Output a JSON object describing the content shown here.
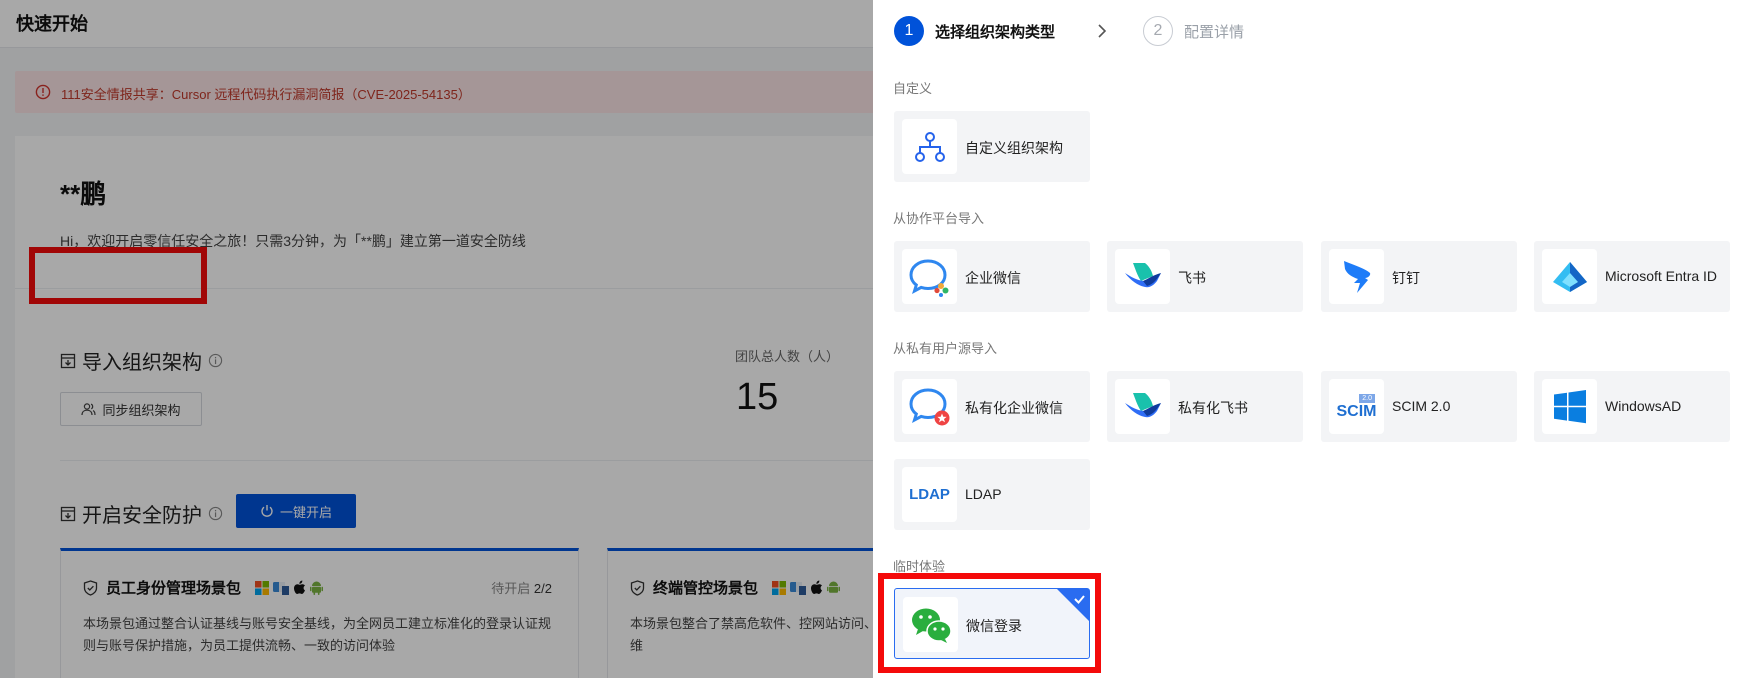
{
  "topbar": {
    "title": "快速开始"
  },
  "alert": {
    "text": "111安全情报共享：Cursor 远程代码执行漏洞简报（CVE-2025-54135）"
  },
  "greeting": {
    "name": "**鹏",
    "message": "Hi，欢迎开启零信任安全之旅！只需3分钟，为「**鹏」建立第一道安全防线"
  },
  "import_section": {
    "title": "导入组织架构",
    "sync_button": "同步组织架构",
    "team_label": "团队总人数（人）",
    "team_count": "15"
  },
  "protect_section": {
    "title": "开启安全防护",
    "enable_button": "一键开启",
    "packages": [
      {
        "title": "员工身份管理场景包",
        "status_prefix": "待开启",
        "status_value": "2/2",
        "desc": "本场景包通过整合认证基线与账号安全基线，为全网员工建立标准化的登录认证规则与账号保护措施，为员工提供流畅、一致的访问体验"
      },
      {
        "title": "终端管控场景包",
        "status_prefix": "",
        "status_value": "",
        "desc": "本场景包整合了禁高危软件、控网站访问、大策略，旨在从内容、网络、外设多个维"
      }
    ]
  },
  "drawer": {
    "steps": [
      {
        "number": "1",
        "label": "选择组织架构类型"
      },
      {
        "number": "2",
        "label": "配置详情"
      }
    ],
    "groups": {
      "custom": "自定义",
      "collab": "从协作平台导入",
      "private": "从私有用户源导入",
      "temp": "临时体验"
    },
    "tiles": {
      "custom_org": "自定义组织架构",
      "wecom": "企业微信",
      "feishu": "飞书",
      "dingtalk": "钉钉",
      "entra": "Microsoft Entra ID",
      "private_wecom": "私有化企业微信",
      "private_feishu": "私有化飞书",
      "scim": "SCIM 2.0",
      "windows_ad": "WindowsAD",
      "ldap": "LDAP",
      "wechat_login": "微信登录"
    },
    "logo_text": {
      "scim": "SCIM",
      "scim_badge": "2.0",
      "ldap": "LDAP"
    },
    "selected_tile": "wechat_login"
  },
  "colors": {
    "primary": "#0052d9",
    "highlight": "#f40a0a",
    "wechat": "#2aae3e",
    "feishu": "#2f6df6",
    "dingtalk": "#1e7cf8"
  }
}
